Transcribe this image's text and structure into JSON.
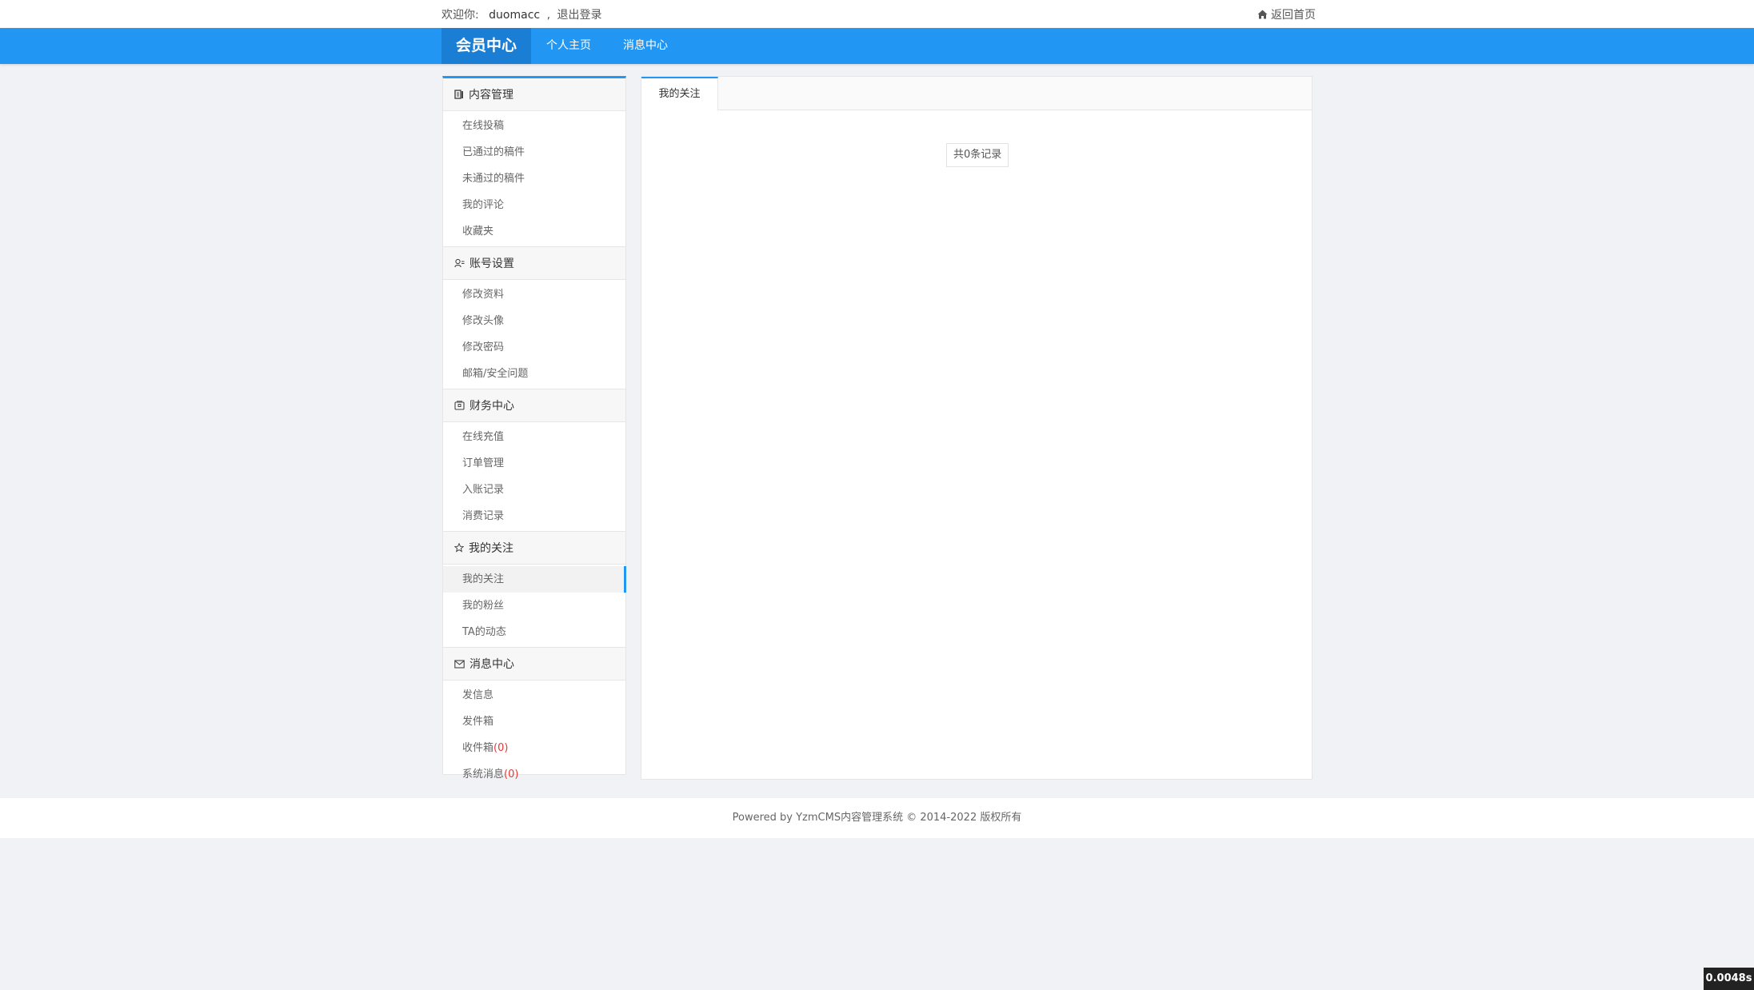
{
  "topbar": {
    "welcome_label": "欢迎你:",
    "username": "duomacc",
    "separator": ",",
    "logout": "退出登录",
    "home_link": "返回首页"
  },
  "navbar": {
    "brand": "会员中心",
    "items": [
      "个人主页",
      "消息中心"
    ]
  },
  "sidebar": {
    "groups": [
      {
        "title": "内容管理",
        "icon": "document-icon",
        "items": [
          "在线投稿",
          "已通过的稿件",
          "未通过的稿件",
          "我的评论",
          "收藏夹"
        ]
      },
      {
        "title": "账号设置",
        "icon": "user-settings-icon",
        "items": [
          "修改资料",
          "修改头像",
          "修改密码",
          "邮箱/安全问题"
        ]
      },
      {
        "title": "财务中心",
        "icon": "wallet-icon",
        "items": [
          "在线充值",
          "订单管理",
          "入账记录",
          "消费记录"
        ]
      },
      {
        "title": "我的关注",
        "icon": "star-icon",
        "items": [
          "我的关注",
          "我的粉丝",
          "TA的动态"
        ]
      },
      {
        "title": "消息中心",
        "icon": "envelope-icon",
        "items": [
          "发信息",
          "发件箱",
          "收件箱",
          "系统消息"
        ],
        "counts": [
          "",
          "",
          "(0)",
          "(0)"
        ]
      }
    ],
    "active_item": "我的关注"
  },
  "main": {
    "tab": "我的关注",
    "records": "共0条记录"
  },
  "footer": {
    "text": "Powered by YzmCMS内容管理系统 © 2014-2022 版权所有"
  },
  "timer": "0.0048s",
  "colors": {
    "primary": "#2196f3",
    "brand_bg": "#1a7fd4",
    "page_bg": "#f1f2f6",
    "count_red": "#e53935"
  }
}
